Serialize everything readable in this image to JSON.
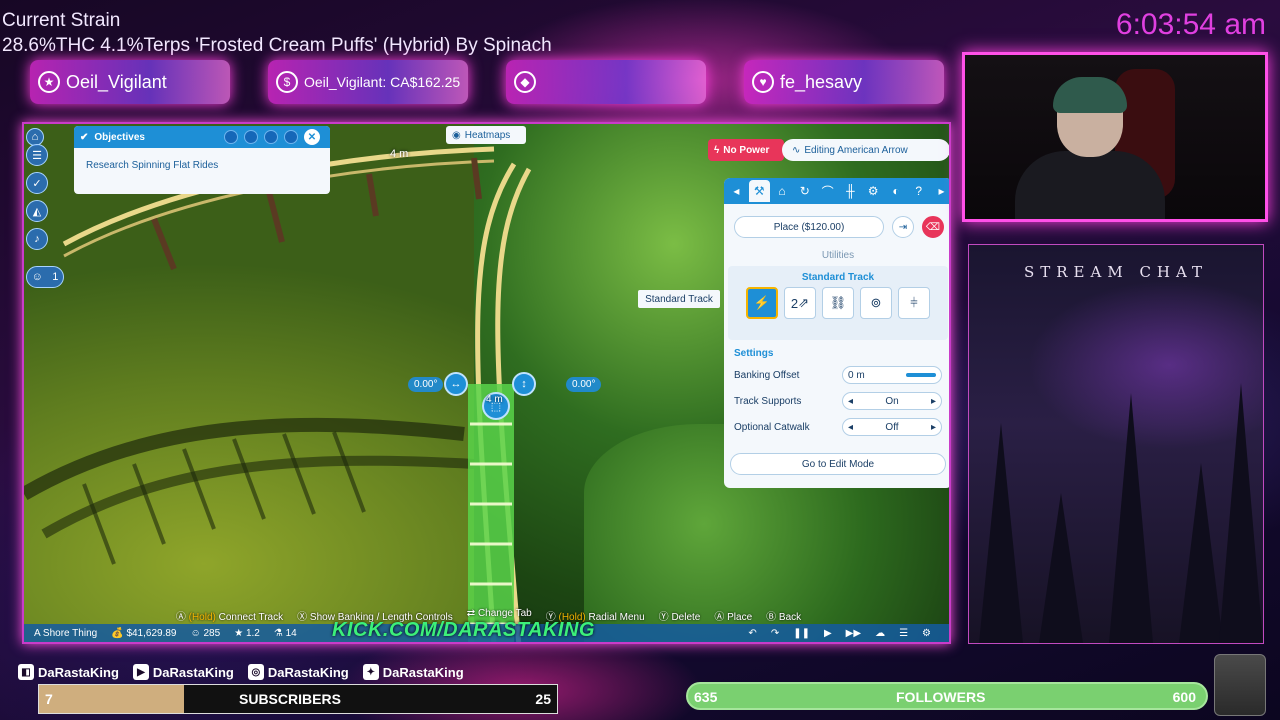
{
  "overlay": {
    "strain_title": "Current Strain",
    "strain_line": "28.6%THC 4.1%Terps 'Frosted Cream Puffs' (Hybrid) By Spinach",
    "clock": "6:03:54 am",
    "alerts": [
      {
        "icon": "star-icon",
        "text": "Oeil_Vigilant"
      },
      {
        "icon": "dollar-icon",
        "text": "Oeil_Vigilant: CA$162.25"
      },
      {
        "icon": "diamond-icon",
        "text": ""
      },
      {
        "icon": "heart-icon",
        "text": "fe_hesavy"
      }
    ],
    "chat_title": "STREAM CHAT"
  },
  "game": {
    "objectives": {
      "title": "Objectives",
      "item": "Research Spinning Flat Rides"
    },
    "heatmaps": "Heatmaps",
    "height_label_top": "4 m",
    "height_label_mid": "4 m",
    "angle_left": "0.00°",
    "angle_right": "0.00°",
    "toolbar_badge": "1",
    "no_power": "No Power",
    "editing": "Editing American Arrow",
    "place_button": "Place ($120.00)",
    "utilities": "Utilities",
    "piece_group": "Standard Track",
    "tooltip": "Standard Track",
    "piece_labels": [
      "",
      "2",
      "",
      "",
      ""
    ],
    "settings_title": "Settings",
    "settings": [
      {
        "label": "Banking Offset",
        "value": "0 m"
      },
      {
        "label": "Track Supports",
        "value": "On"
      },
      {
        "label": "Optional Catwalk",
        "value": "Off"
      }
    ],
    "edit_mode": "Go to Edit Mode",
    "hints": [
      {
        "btn": "A",
        "hold": "(Hold)",
        "text": "Connect Track"
      },
      {
        "btn": "X",
        "hold": "",
        "text": "Show Banking / Length Controls"
      },
      {
        "btn": "LB RB",
        "hold": "",
        "text": "Change Tab"
      },
      {
        "btn": "Y",
        "hold": "(Hold)",
        "text": "Radial Menu"
      },
      {
        "btn": "Y",
        "hold": "",
        "text": "Delete"
      },
      {
        "btn": "A",
        "hold": "",
        "text": "Place"
      },
      {
        "btn": "B",
        "hold": "",
        "text": "Back"
      }
    ],
    "status": {
      "park": "A Shore Thing",
      "money": "$41,629.89",
      "guests": "285",
      "rating": "1.2",
      "research": "14"
    },
    "kick": "KICK.COM/DARASTAKING"
  },
  "socials": [
    {
      "icon": "twitch-icon",
      "handle": "DaRastaKing"
    },
    {
      "icon": "youtube-icon",
      "handle": "DaRastaKing"
    },
    {
      "icon": "instagram-icon",
      "handle": "DaRastaKing"
    },
    {
      "icon": "twitter-icon",
      "handle": "DaRastaKing"
    }
  ],
  "subscribers": {
    "current": "7",
    "label": "SUBSCRIBERS",
    "goal": "25",
    "progress": 0.28
  },
  "followers": {
    "current": "635",
    "label": "FOLLOWERS",
    "goal": "600",
    "progress": 1.0
  },
  "colors": {
    "accent": "#ff40e0",
    "game_blue": "#1e8fd6",
    "follower_green": "#7ad070"
  }
}
